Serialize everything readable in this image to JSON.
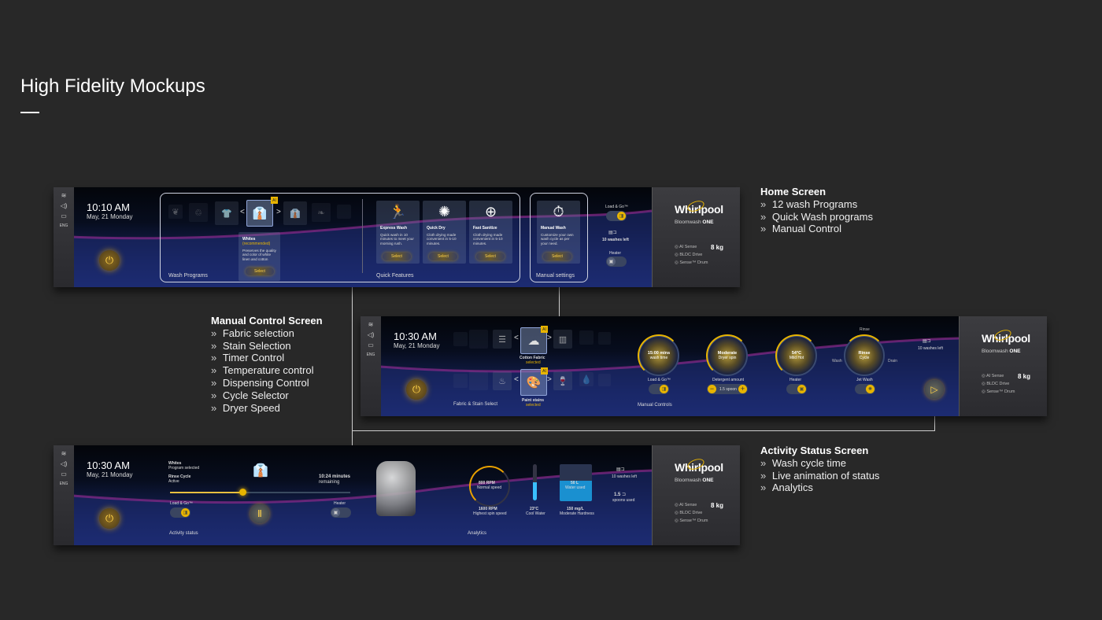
{
  "page": {
    "title": "High Fidelity Mockups"
  },
  "notes": {
    "home": {
      "heading": "Home Screen",
      "items": [
        "12 wash Programs",
        "Quick Wash programs",
        "Manual Control"
      ]
    },
    "manual": {
      "heading": "Manual Control Screen",
      "items": [
        "Fabric selection",
        "Stain Selection",
        "Timer Control",
        "Temperature control",
        "Dispensing Control",
        "Cycle Selector",
        "Dryer Speed"
      ]
    },
    "activity": {
      "heading": "Activity Status Screen",
      "items": [
        "Wash cycle time",
        "Live animation of status",
        "Analytics"
      ]
    }
  },
  "common": {
    "language": "ENG",
    "date": "May, 21 Monday",
    "brand": "Whirlpool",
    "model_prefix": "Bloomwash",
    "model_suffix": "ONE",
    "features": [
      "AI Sense",
      "BLDC Drive",
      "Sense™ Drum"
    ],
    "capacity": "8 kg",
    "ai_badge": "AI",
    "accent": "#e8b400"
  },
  "home": {
    "time": "10:10 AM",
    "program": {
      "name": "Whites",
      "tag": "(recommended)",
      "desc": "Preserves the quality and color of white linen and cotton",
      "select": "Select"
    },
    "wash_programs_label": "Wash Programs",
    "quick_features_label": "Quick Features",
    "quick_features": [
      {
        "title": "Express Wash",
        "desc": "Quick wash in 10 minutes to meet your morning rush.",
        "select": "Select",
        "icon": "running-icon"
      },
      {
        "title": "Quick Dry",
        "desc": "Cloth drying made convenient in 5-10 minutes.",
        "select": "Select",
        "icon": "fan-icon"
      },
      {
        "title": "Fast Sanitize",
        "desc": "Cloth drying made convenient in 5-10 minutes.",
        "select": "Select",
        "icon": "sanitize-icon"
      }
    ],
    "manual": {
      "title": "Manual Wash",
      "desc": "Customize your own wash cycle as per your need.",
      "select": "Select"
    },
    "manual_settings_label": "Manual settings",
    "load_and_go": "Load & Go™",
    "washes_left": "10 washes left",
    "heater": "Heater"
  },
  "manual_screen": {
    "time": "10:30 AM",
    "fabric": {
      "name": "Cotton Fabric",
      "state": "selected"
    },
    "stain": {
      "name": "Paint stains",
      "state": "selected"
    },
    "section_label": "Fabric  & Stain Select",
    "controls_label": "Manual Controls",
    "dials": [
      {
        "value": "15:00 mins",
        "label": "wash time",
        "caption": "Load & Go™"
      },
      {
        "value": "Moderate",
        "label": "Dryer spin",
        "caption": "Detergent amount"
      },
      {
        "value": "54°C",
        "label": "Mild Hot",
        "caption": "Heater"
      },
      {
        "value": "Rinse",
        "label": "Cycle",
        "caption": "Jet Wash"
      }
    ],
    "cycle_labels": {
      "top": "Rinse",
      "left": "Wash",
      "right": "Drain"
    },
    "detergent": "1.5 spoon",
    "washes_left": "10 washes left"
  },
  "activity_screen": {
    "time": "10:30 AM",
    "program": "Whites",
    "program_sub": "Program selected",
    "cycle": "Rinse Cycle",
    "cycle_sub": "Active",
    "remaining": "10:24 minutes",
    "remaining_sub": "remaining",
    "progress": 0.4,
    "load_and_go": "Load & Go™",
    "heater": "Heater",
    "status_label": "Activity status",
    "analytics_label": "Analytics",
    "speed": "800 RPM",
    "speed_sub": "Normal speed",
    "max_speed": "1600 RPM",
    "max_speed_sub": "Highest spin speed",
    "temp": "23°C",
    "temp_sub": "Cool Water",
    "water": "50 L",
    "water_sub": "Water used",
    "hardness": "150 mg/L",
    "hardness_sub": "Moderate Hardness",
    "washes_left": "10 washes left",
    "spoons": "1.5",
    "spoons_sub": "spoons used"
  }
}
